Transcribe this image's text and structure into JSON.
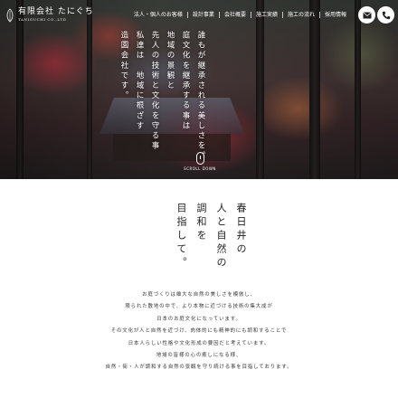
{
  "header": {
    "logo_name": "有限会社 たにぐち",
    "logo_sub": "TANIGUCHI CO.,LTD",
    "nav": [
      "法人・個人のお客様",
      "設計事業",
      "会社概要",
      "施工実績",
      "施工の流れ",
      "採用情報"
    ],
    "mail_icon": "mail-icon",
    "tel_icon": "phone-icon"
  },
  "hero": {
    "lines": [
      "誰もが継承される美しさを。",
      "庭文化を継承する事は",
      "地域の景観と",
      "先人の技術と文化を守る事",
      "私達は　地域に根ざす",
      "造園会社です。"
    ],
    "scroll_label": "SCROLL DOWN"
  },
  "intro": {
    "heading_lines": [
      "春日井の",
      "人と自然の",
      "調和を",
      "目指して。"
    ],
    "body_lines": [
      "お庭づくりは雄大な自然の美しさを模倣し、",
      "限られた敷地の中で、より本物に近づける技術の集大成が",
      "日本のお庭文化になっています。",
      "その文化が人と自然を近づけ、肉体的にも精神的にも調和することで",
      "日本人らしい性格や文化形成の要因だと考えています。",
      "地域の皆様の心の癒しになる様、",
      "自然・街・人が調和する自然の景観を守り続ける事を目指しております。"
    ]
  },
  "colors": {
    "accent": "#ffffff",
    "text": "#2a2a2a"
  }
}
